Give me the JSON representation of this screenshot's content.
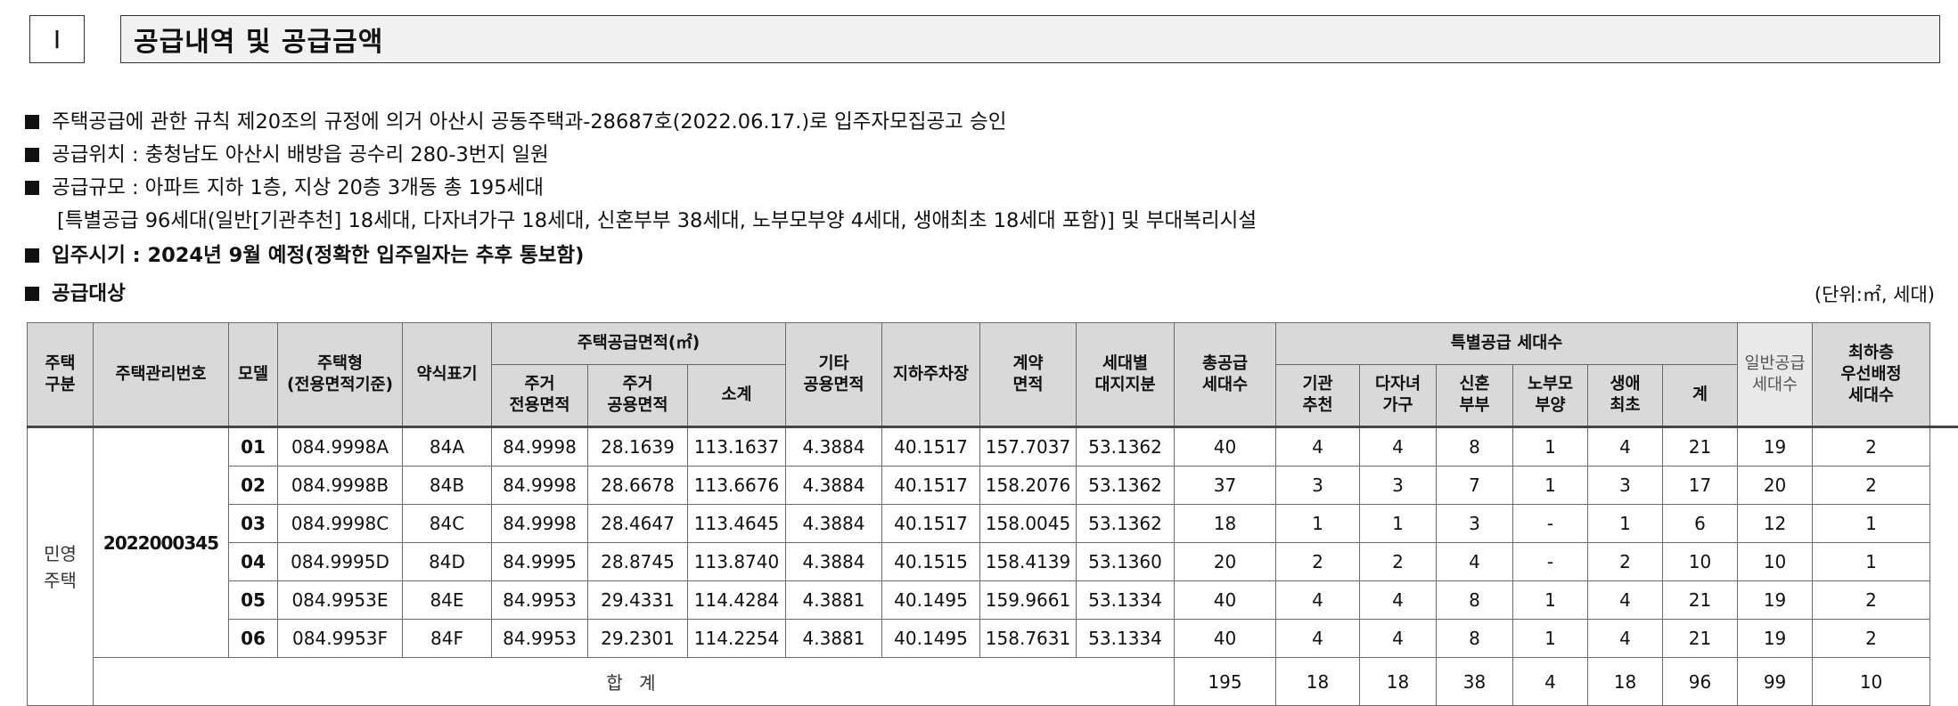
{
  "section": {
    "number": "Ⅰ",
    "title": "공급내역 및 공급금액"
  },
  "notes": [
    {
      "text": "주택공급에 관한 규칙 제20조의 규정에 의거 아산시 공동주택과-28687호(2022.06.17.)로 입주자모집공고 승인",
      "bullet": true
    },
    {
      "text": "공급위치 : 충청남도 아산시 배방읍 공수리 280-3번지 일원",
      "bullet": true
    },
    {
      "text": "공급규모 : 아파트 지하 1층, 지상 20층 3개동 총 195세대",
      "bullet": true
    },
    {
      "text": "[특별공급 96세대(일반[기관추천] 18세대, 다자녀가구 18세대, 신혼부부 38세대, 노부모부양 4세대, 생애최초 18세대 포함)] 및 부대복리시설",
      "bullet": false
    },
    {
      "text": "입주시기 : 2024년 9월 예정(정확한 입주일자는 추후 통보함)",
      "bullet": true,
      "bold": true
    },
    {
      "text": "공급대상",
      "bullet": true,
      "bold": true
    }
  ],
  "unit_note": "(단위:㎡, 세대)",
  "table": {
    "headers": {
      "housing_type": "주택\n구분",
      "mgmt_no": "주택관리번호",
      "model": "모델",
      "house_type": "주택형\n(전용면적기준)",
      "abbr": "약식표기",
      "supply_area": "주택공급면적(㎡)",
      "exclusive": "주거\n전용면적",
      "common": "주거\n공용면적",
      "subtotal": "소계",
      "other_common": "기타\n공용면적",
      "parking": "지하주차장",
      "contract": "계약\n면적",
      "land": "세대별\n대지지분",
      "total_units": "총공급\n세대수",
      "special": "특별공급 세대수",
      "inst": "기관\n추천",
      "multi": "다자녀\n가구",
      "newlywed": "신혼\n부부",
      "elderly": "노부모\n부양",
      "first": "생애\n최초",
      "special_sum": "계",
      "general": "일반공급\n세대수",
      "top_floor": "최하층\n우선배정\n세대수"
    },
    "category": "민영\n주택",
    "mgmt_no": "2022000345",
    "rows": [
      [
        "01",
        "084.9998A",
        "84A",
        "84.9998",
        "28.1639",
        "113.1637",
        "4.3884",
        "40.1517",
        "157.7037",
        "53.1362",
        "40",
        "4",
        "4",
        "8",
        "1",
        "4",
        "21",
        "19",
        "2"
      ],
      [
        "02",
        "084.9998B",
        "84B",
        "84.9998",
        "28.6678",
        "113.6676",
        "4.3884",
        "40.1517",
        "158.2076",
        "53.1362",
        "37",
        "3",
        "3",
        "7",
        "1",
        "3",
        "17",
        "20",
        "2"
      ],
      [
        "03",
        "084.9998C",
        "84C",
        "84.9998",
        "28.4647",
        "113.4645",
        "4.3884",
        "40.1517",
        "158.0045",
        "53.1362",
        "18",
        "1",
        "1",
        "3",
        "-",
        "1",
        "6",
        "12",
        "1"
      ],
      [
        "04",
        "084.9995D",
        "84D",
        "84.9995",
        "28.8745",
        "113.8740",
        "4.3884",
        "40.1515",
        "158.4139",
        "53.1360",
        "20",
        "2",
        "2",
        "4",
        "-",
        "2",
        "10",
        "10",
        "1"
      ],
      [
        "05",
        "084.9953E",
        "84E",
        "84.9953",
        "29.4331",
        "114.4284",
        "4.3881",
        "40.1495",
        "159.9661",
        "53.1334",
        "40",
        "4",
        "4",
        "8",
        "1",
        "4",
        "21",
        "19",
        "2"
      ],
      [
        "06",
        "084.9953F",
        "84F",
        "84.9953",
        "29.2301",
        "114.2254",
        "4.3881",
        "40.1495",
        "158.7631",
        "53.1334",
        "40",
        "4",
        "4",
        "8",
        "1",
        "4",
        "21",
        "19",
        "2"
      ]
    ],
    "total": {
      "label": "합 계",
      "values": [
        "195",
        "18",
        "18",
        "38",
        "4",
        "18",
        "96",
        "99",
        "10"
      ]
    }
  }
}
